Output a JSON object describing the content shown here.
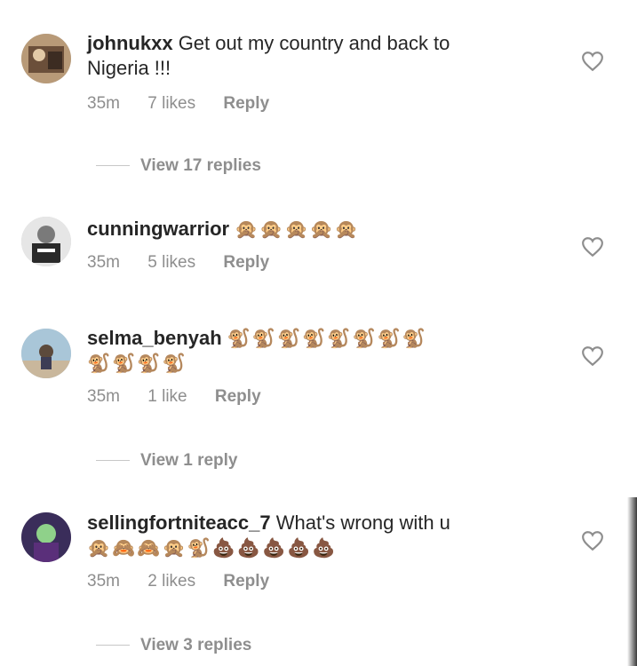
{
  "comments": [
    {
      "username": "johnukxx",
      "text": " Get out my country and back to",
      "text_line2": "Nigeria !!!",
      "time": "35m",
      "likes": "7 likes",
      "reply": "Reply",
      "view_replies": "View 17 replies",
      "avatar_color": "#a38a6e"
    },
    {
      "username": "cunningwarrior",
      "emoji": "🙊🙊🙊🙊🙊",
      "time": "35m",
      "likes": "5 likes",
      "reply": "Reply",
      "avatar_color": "#d8d8d8"
    },
    {
      "username": "selma_benyah",
      "emoji": "🐒🐒🐒🐒🐒🐒🐒🐒",
      "emoji_line2": "🐒🐒🐒🐒",
      "time": "35m",
      "likes": "1 like",
      "reply": "Reply",
      "view_replies": "View 1 reply",
      "avatar_color": "#8fb3c9"
    },
    {
      "username": "sellingfortniteacc_7",
      "text": " What's wrong with u",
      "emoji_line2": "🙊🙈🙈🙊🐒💩💩💩💩💩",
      "time": "35m",
      "likes": "2 likes",
      "reply": "Reply",
      "view_replies": "View 3 replies",
      "avatar_color": "#4a3a6b"
    }
  ],
  "icons": {
    "like": "heart-icon"
  }
}
